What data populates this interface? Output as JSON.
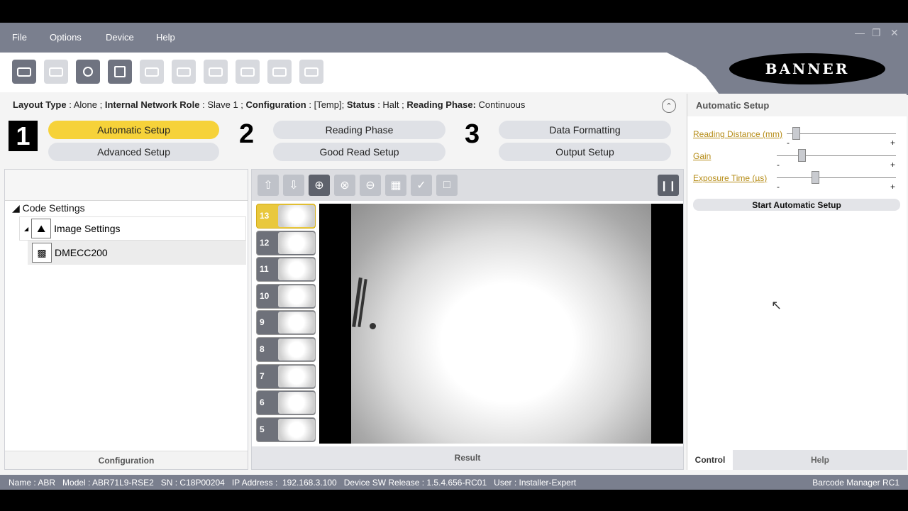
{
  "menu": {
    "file": "File",
    "options": "Options",
    "device": "Device",
    "help": "Help"
  },
  "brand": {
    "logo_text": "BANNER"
  },
  "status_line": {
    "layout_type_label": "Layout Type",
    "layout_type_value": "Alone",
    "network_role_label": "Internal Network Role",
    "network_role_value": "Slave 1",
    "configuration_label": "Configuration",
    "configuration_value": "[Temp]",
    "status_label": "Status",
    "status_value": "Halt",
    "reading_phase_label": "Reading Phase:",
    "reading_phase_value": "Continuous"
  },
  "steps": {
    "step1_num": "1",
    "step2_num": "2",
    "step3_num": "3",
    "automatic_setup": "Automatic Setup",
    "advanced_setup": "Advanced Setup",
    "reading_phase": "Reading Phase",
    "good_read_setup": "Good Read Setup",
    "data_formatting": "Data Formatting",
    "output_setup": "Output Setup"
  },
  "tree": {
    "code_settings": "Code Settings",
    "image_settings": "Image Settings",
    "dmecc200": "DMECC200"
  },
  "left_footer": "Configuration",
  "thumbnails": [
    "13",
    "12",
    "11",
    "10",
    "9",
    "8",
    "7",
    "6",
    "5"
  ],
  "mid_footer": "Result",
  "right_panel": {
    "title": "Automatic Setup",
    "reading_distance": "Reading Distance (mm)",
    "gain": "Gain",
    "exposure_time": "Exposure Time (µs)",
    "minus": "-",
    "plus": "+",
    "start_button": "Start Automatic Setup",
    "tab_control": "Control",
    "tab_help": "Help"
  },
  "status_bar": {
    "left": "Name : ABR   Model : ABR71L9-RSE2   SN : C18P00204   IP Address :  192.168.3.100   Device SW Release : 1.5.4.656-RC01   User : Installer-Expert",
    "right": "Barcode Manager RC1"
  },
  "colors": {
    "accent": "#f6d23a",
    "chrome": "#7a7f8e"
  }
}
